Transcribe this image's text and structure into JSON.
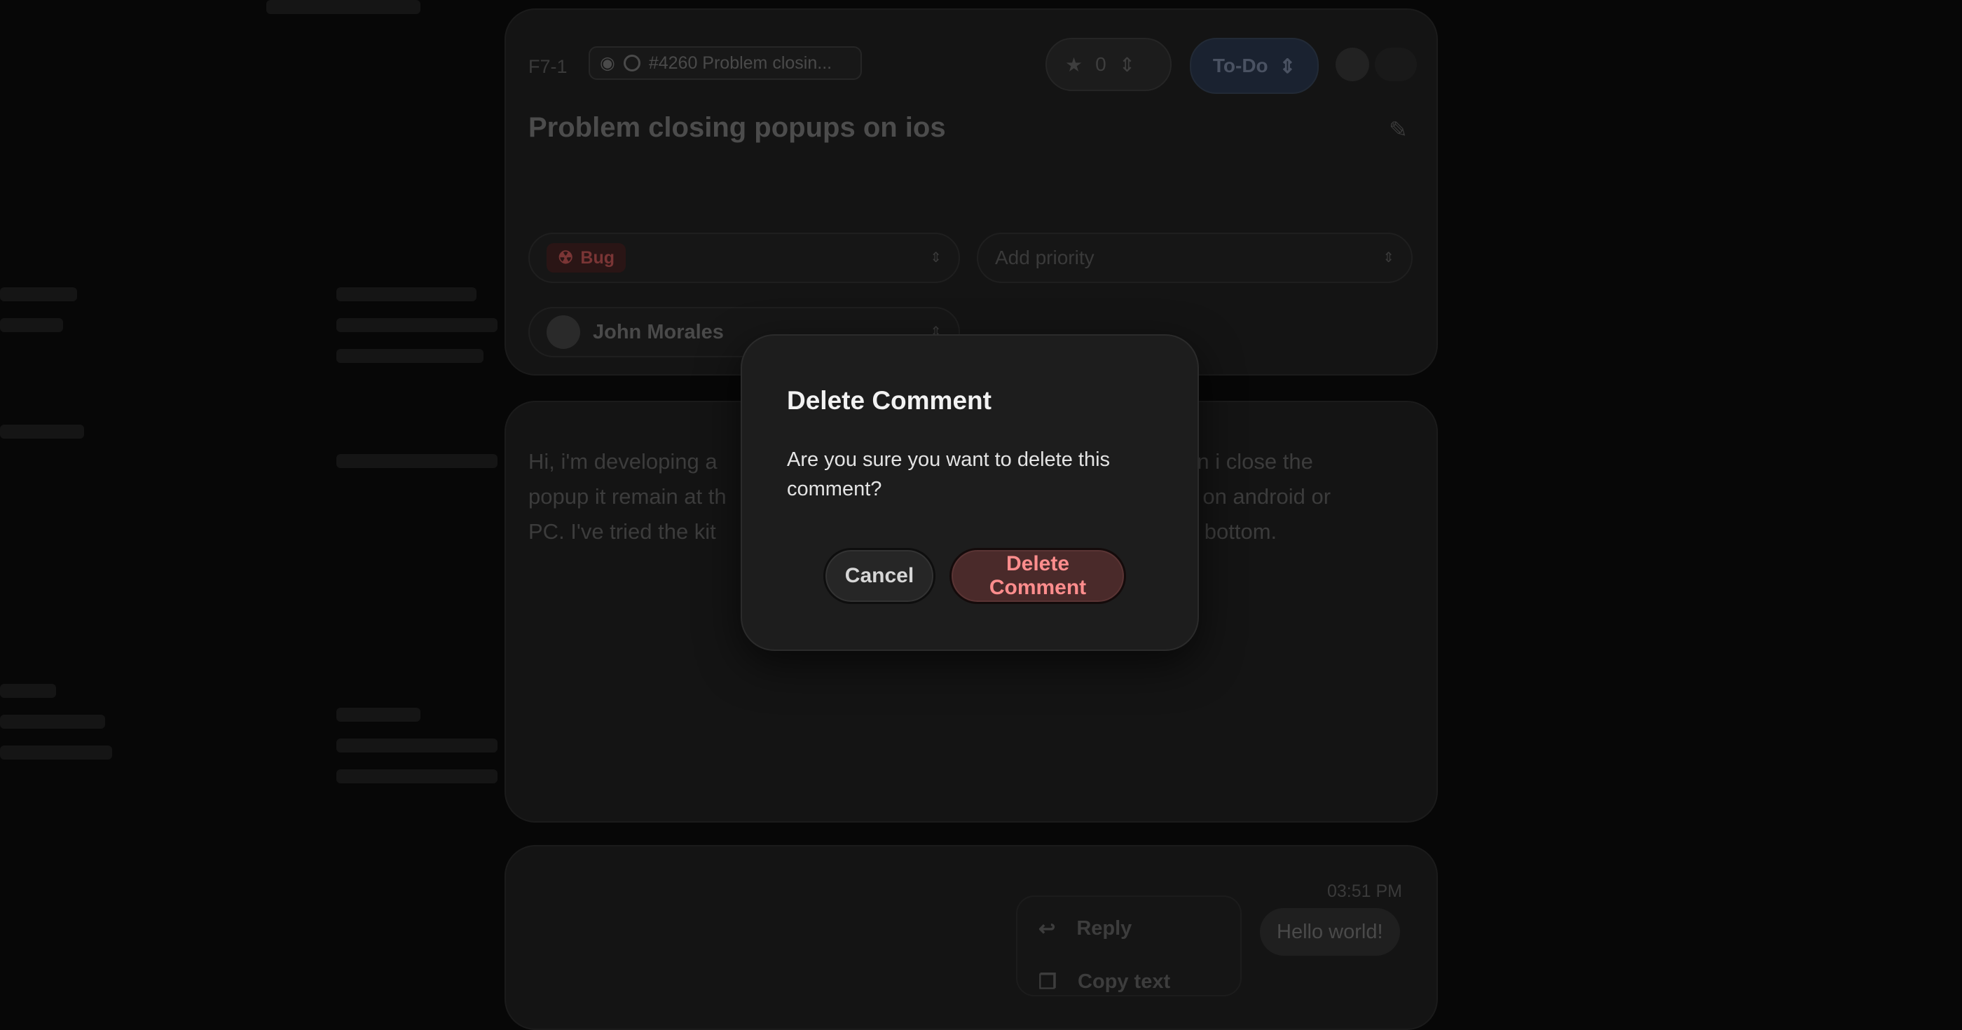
{
  "issue": {
    "id": "F7-1",
    "github_ref": "#4260 Problem closin...",
    "star_count": "0",
    "status": "To-Do",
    "title": "Problem closing popups on ios",
    "type_label": "Bug",
    "priority_placeholder": "Add priority",
    "assignee": "John Morales"
  },
  "description": {
    "line1_left": "Hi, i'm developing a",
    "line1_right": "when i close the",
    "line2_left": "popup it remain at th",
    "line2_right": "not on android or",
    "line3_left": "PC. I've tried the kit",
    "line3_right": "t the bottom."
  },
  "comments": {
    "timestamp": "03:51 PM",
    "bubble": "Hello world!",
    "menu": {
      "reply": "Reply",
      "copy": "Copy text"
    }
  },
  "modal": {
    "title": "Delete Comment",
    "body": "Are you sure you want to delete this comment?",
    "cancel_label": "Cancel",
    "delete_label": "Delete Comment"
  },
  "colors": {
    "background": "#070707",
    "modal": "#1d1d1d",
    "danger_bg": "#4a2a2a",
    "danger_text": "#ff8d8d"
  }
}
